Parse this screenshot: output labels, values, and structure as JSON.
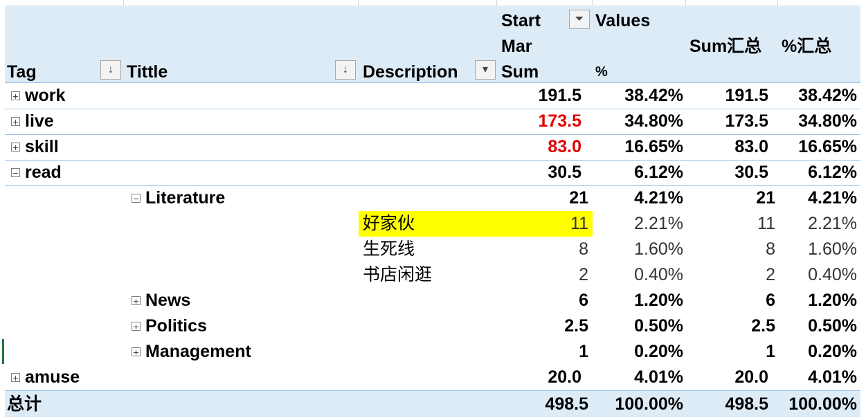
{
  "headers": {
    "tag": "Tag",
    "title": "Tittle",
    "description": "Description",
    "start_line1": "Start",
    "start_line2": "Mar",
    "start_line3": "Sum",
    "values": "Values",
    "pct": "%",
    "sum_total": "Sum汇总",
    "pct_total": "%汇总"
  },
  "icons": {
    "sort": "sort-arrow-icon",
    "filter": "filter-icon",
    "dropdown": "chevron-down-icon",
    "expand": "plus-box-icon",
    "collapse": "minus-box-icon"
  },
  "rows": {
    "work": {
      "label": "work",
      "sum": "191.5",
      "pct": "38.42%",
      "sum2": "191.5",
      "pct2": "38.42%"
    },
    "live": {
      "label": "live",
      "sum": "173.5",
      "pct": "34.80%",
      "sum2": "173.5",
      "pct2": "34.80%"
    },
    "skill": {
      "label": "skill",
      "sum": "83.0",
      "pct": "16.65%",
      "sum2": "83.0",
      "pct2": "16.65%"
    },
    "read": {
      "label": "read",
      "sum": "30.5",
      "pct": "6.12%",
      "sum2": "30.5",
      "pct2": "6.12%"
    },
    "literature": {
      "label": "Literature",
      "sum": "21",
      "pct": "4.21%",
      "sum2": "21",
      "pct2": "4.21%"
    },
    "lit1": {
      "label": "好家伙",
      "sum": "11",
      "pct": "2.21%",
      "sum2": "11",
      "pct2": "2.21%"
    },
    "lit2": {
      "label": "生死线",
      "sum": "8",
      "pct": "1.60%",
      "sum2": "8",
      "pct2": "1.60%"
    },
    "lit3": {
      "label": "书店闲逛",
      "sum": "2",
      "pct": "0.40%",
      "sum2": "2",
      "pct2": "0.40%"
    },
    "news": {
      "label": "News",
      "sum": "6",
      "pct": "1.20%",
      "sum2": "6",
      "pct2": "1.20%"
    },
    "politics": {
      "label": "Politics",
      "sum": "2.5",
      "pct": "0.50%",
      "sum2": "2.5",
      "pct2": "0.50%"
    },
    "management": {
      "label": "Management",
      "sum": "1",
      "pct": "0.20%",
      "sum2": "1",
      "pct2": "0.20%"
    },
    "amuse": {
      "label": "amuse",
      "sum": "20.0",
      "pct": "4.01%",
      "sum2": "20.0",
      "pct2": "4.01%"
    }
  },
  "total": {
    "label": "总计",
    "sum": "498.5",
    "pct": "100.00%",
    "sum2": "498.5",
    "pct2": "100.00%"
  },
  "toggles": {
    "expand": "+",
    "collapse": "−"
  },
  "colors": {
    "header_fill": "#ddebf7",
    "header_border": "#9bc2e6",
    "highlight": "#ffff00",
    "red_value": "#e00000"
  }
}
